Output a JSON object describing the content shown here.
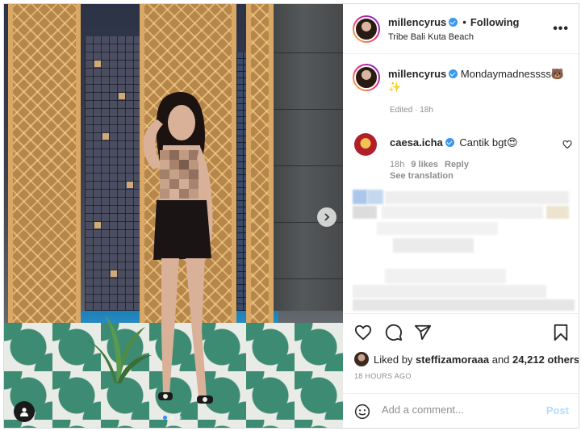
{
  "post": {
    "username": "millencyrus",
    "following_label": "Following",
    "location": "Tribe Bali Kuta Beach",
    "more_label": "•••",
    "caption": "Mondaymadnessss",
    "caption_emoji_1": "🐻",
    "caption_emoji_2": "✨",
    "edited_label": "Edited · 18h"
  },
  "comment": {
    "username": "caesa.icha",
    "text": "Cantik bgt😍",
    "time": "18h",
    "likes": "9 likes",
    "reply": "Reply",
    "translation": "See translation"
  },
  "likes": {
    "prefix": "Liked by",
    "user": "steffizamoraaa",
    "and": "and",
    "count": "24,212 others"
  },
  "time_ago": "18 HOURS AGO",
  "composer": {
    "placeholder": "Add a comment...",
    "post_label": "Post"
  },
  "icons": [
    "heart-icon",
    "comment-icon",
    "share-icon",
    "bookmark-icon",
    "emoji-icon",
    "user-tag-icon",
    "chevron-right-icon",
    "more-icon",
    "verified-icon"
  ],
  "colors": {
    "verified": "#3897f0",
    "post_disabled": "#b3dbff",
    "muted": "#8e8e8e"
  }
}
